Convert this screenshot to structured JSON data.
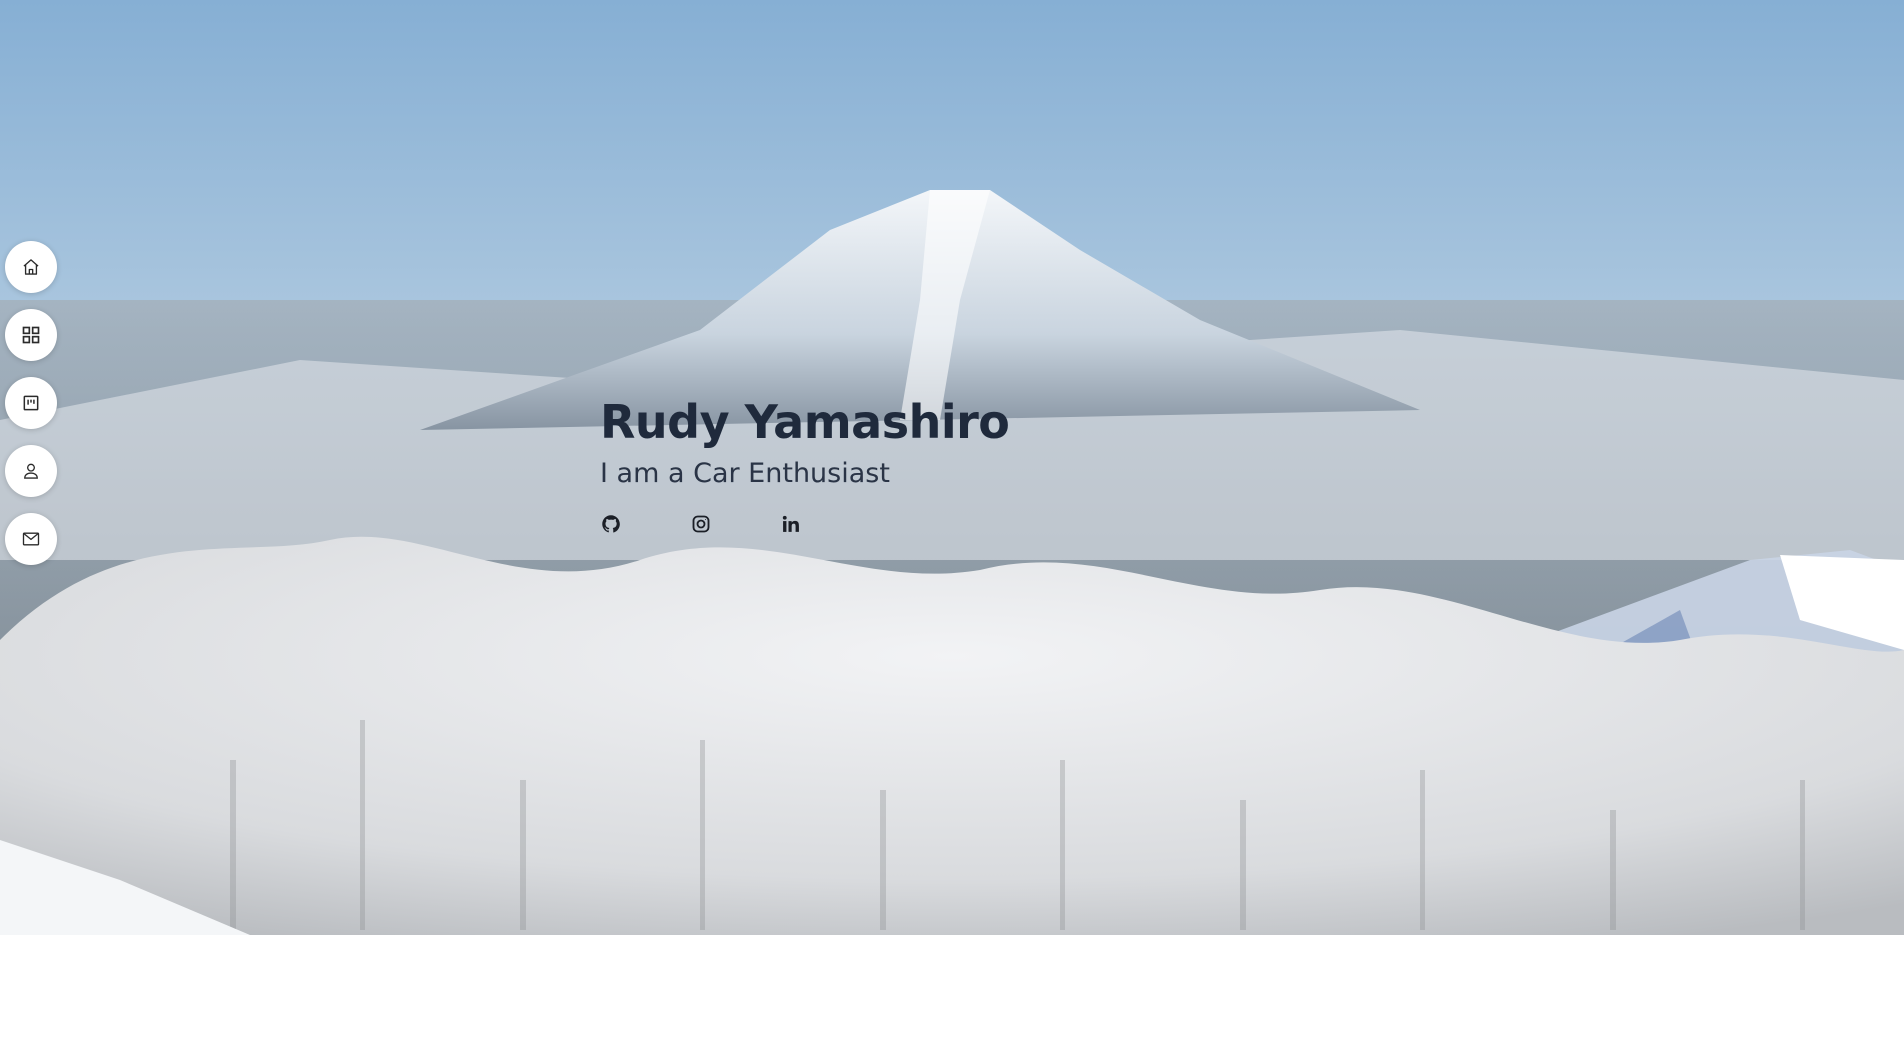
{
  "hero": {
    "title": "Rudy Yamashiro",
    "subtitle": "I am a Car Enthusiast"
  },
  "social": [
    {
      "name": "github-icon"
    },
    {
      "name": "instagram-icon"
    },
    {
      "name": "linkedin-icon"
    }
  ],
  "nav": [
    {
      "name": "home-icon"
    },
    {
      "name": "grid-icon"
    },
    {
      "name": "kanban-icon"
    },
    {
      "name": "user-icon"
    },
    {
      "name": "mail-icon"
    }
  ],
  "colors": {
    "title": "#1f2a3c",
    "subtitle": "#2a3446",
    "nav_bg": "#ffffff"
  }
}
